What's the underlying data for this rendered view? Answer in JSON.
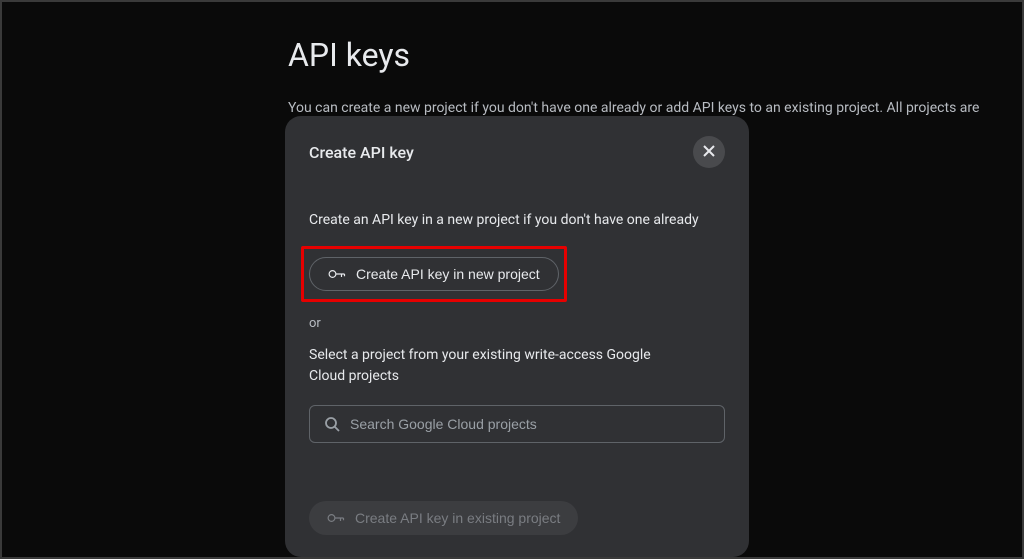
{
  "page": {
    "title": "API keys",
    "description": "You can create a new project if you don't have one already or add API keys to an existing project. All projects are"
  },
  "modal": {
    "title": "Create API key",
    "instruction": "Create an API key in a new project if you don't have one already",
    "createNewButton": "Create API key in new project",
    "orText": "or",
    "selectText": "Select a project from your existing write-access Google Cloud projects",
    "searchPlaceholder": "Search Google Cloud projects",
    "createExistingButton": "Create API key in existing project"
  }
}
